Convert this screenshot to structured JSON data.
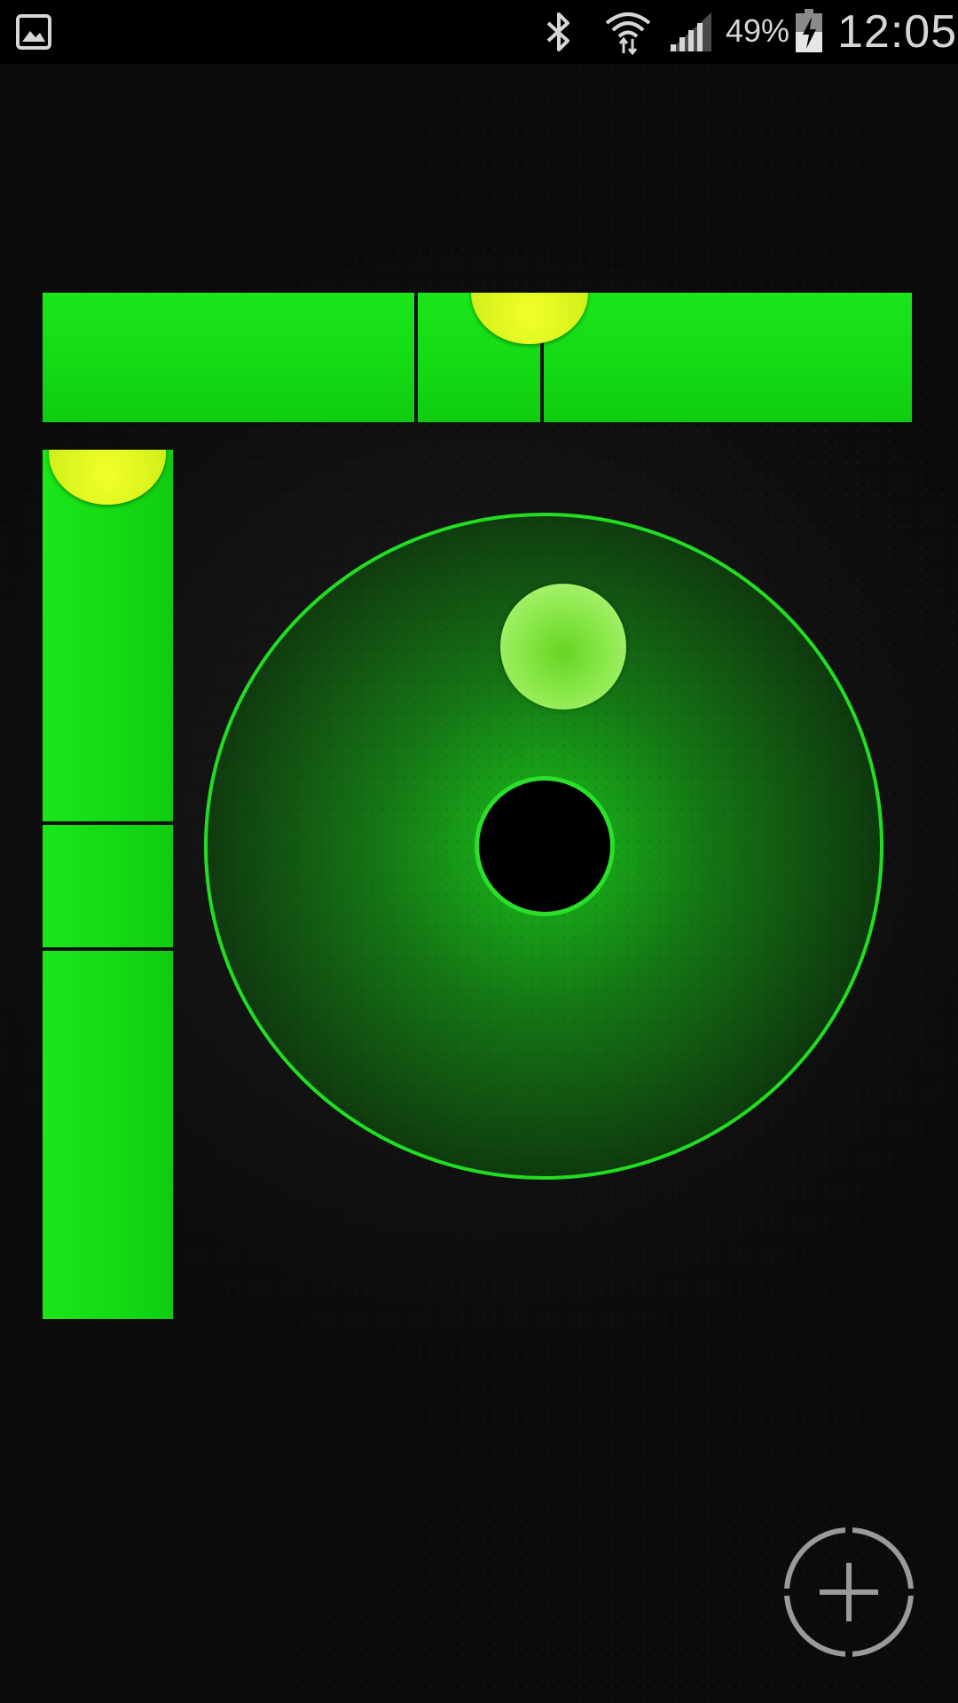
{
  "status_bar": {
    "battery_percent": "49%",
    "time": "12:05",
    "icons": [
      "gallery-notification-icon",
      "bluetooth-icon",
      "wifi-icon",
      "signal-icon",
      "battery-charging-icon"
    ]
  },
  "level": {
    "horizontal_bubble_position": 0.56,
    "vertical_bubble_position": 0.06,
    "bullseye_ball_offset": {
      "x": 0.07,
      "y": -0.72
    }
  },
  "colors": {
    "tube_green": "#14d914",
    "bubble_yellow": "#e6f51f",
    "ring_green": "#22dd22",
    "ball_green": "#8ae84a"
  },
  "actions": {
    "calibrate_icon": "crosshair-plus-icon"
  }
}
